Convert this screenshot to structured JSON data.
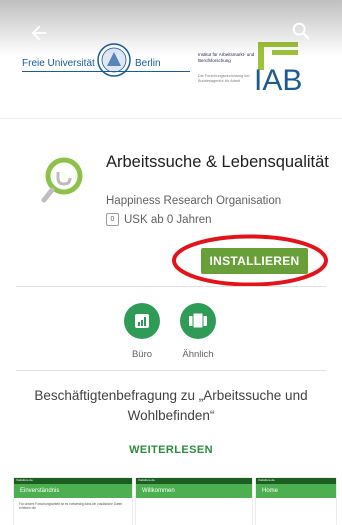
{
  "header": {
    "fu_logo_text_left": "Freie Universität",
    "fu_logo_text_right": "Berlin",
    "iab_small_text": "Institut für Arbeitsmarkt- und Berufsforschung",
    "iab_small_text2": "Die Forschungseinrichtung der Bundesagentur für Arbeit",
    "iab_logo_text": "IAB",
    "icons": [
      "back-arrow-icon",
      "search-icon"
    ]
  },
  "app": {
    "title": "Arbeitssuche & Lebensqualität",
    "developer": "Happiness Research Organisation",
    "usk_badge": "0",
    "age_rating": "USK ab 0 Jahren",
    "install_label": "INSTALLIEREN",
    "accent_color": "#689f38",
    "highlight_color": "#e3131b"
  },
  "categories": [
    {
      "label": "Büro",
      "icon": "bar-chart-icon"
    },
    {
      "label": "Ähnlich",
      "icon": "cards-icon"
    }
  ],
  "description": {
    "text": "Beschäftigtenbefragung zu „Arbeitssuche und Wohlbefinden“",
    "read_more": "WEITERLESEN"
  },
  "screenshots": [
    {
      "title": "Einverständnis",
      "status": "Vodafone.de",
      "body": "Für unsere Forschungsarbeit ist es notwendig dass wir zusätzliche Daten erheben die"
    },
    {
      "title": "Willkommen",
      "status": "Vodafone.de",
      "body": ""
    },
    {
      "title": "Home",
      "status": "Vodafone.de",
      "body": ""
    }
  ]
}
